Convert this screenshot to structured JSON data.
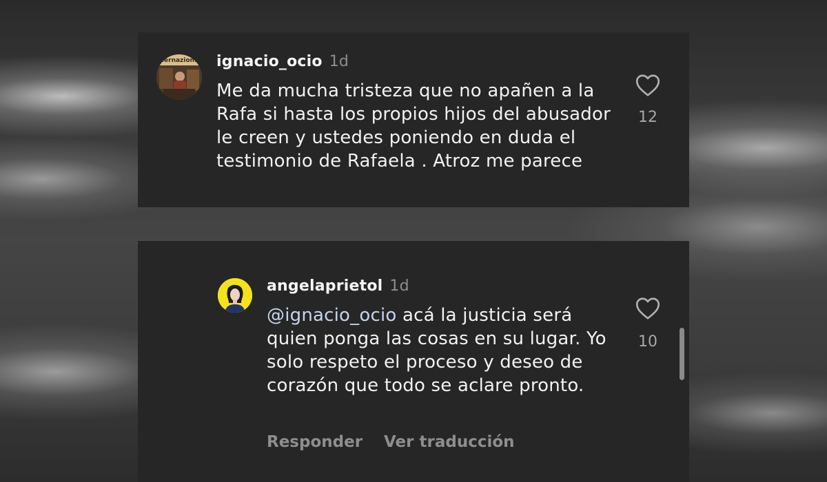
{
  "comments": [
    {
      "username": "ignacio_ocio",
      "time": "1d",
      "text": "Me da mucha tristeza que no apañen a la Rafa si hasta los propios hijos del abusador le creen y ustedes poniendo en duda el testimonio de Rafaela . Atroz me parece",
      "likes": "12",
      "avatar_text": "...ernazion..."
    },
    {
      "username": "angelaprietol",
      "time": "1d",
      "mention": "@ignacio_ocio",
      "text": " acá la justicia será quien ponga las cosas en su lugar. Yo solo respeto el proceso y deseo de corazón que todo se aclare pronto.",
      "likes": "10",
      "actions": {
        "reply": "Responder",
        "translate": "Ver traducción"
      }
    }
  ],
  "icons": {
    "like": "heart-outline-icon"
  },
  "colors": {
    "card_bg": "#262626",
    "mention": "#c7d4ee",
    "meta": "#8e8e8e"
  }
}
